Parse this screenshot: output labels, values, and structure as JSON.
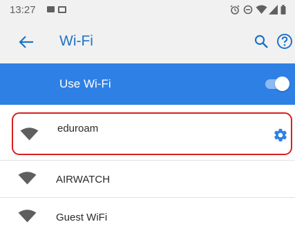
{
  "status_bar": {
    "time": "13:27",
    "left_icons": [
      "photo-icon",
      "mail-icon"
    ],
    "right_icons": [
      "alarm-icon",
      "do-not-disturb-icon",
      "wifi-signal-icon",
      "cell-signal-icon",
      "battery-icon"
    ]
  },
  "app_bar": {
    "title": "Wi-Fi",
    "back_icon": "arrow-back-icon",
    "actions": [
      "search-icon",
      "help-icon"
    ]
  },
  "master_switch": {
    "label": "Use Wi-Fi",
    "enabled": true
  },
  "networks": [
    {
      "ssid": "eduroam",
      "connected": true,
      "has_settings": true,
      "highlighted": true
    },
    {
      "ssid": "AIRWATCH",
      "connected": false,
      "has_settings": false,
      "highlighted": false
    },
    {
      "ssid": "Guest WiFi",
      "connected": false,
      "has_settings": false,
      "highlighted": false
    }
  ],
  "colors": {
    "accent_blue": "#2f80e4",
    "title_blue": "#1e73c6",
    "highlight_red": "#d81f1f",
    "status_bar_bg": "#f1f1f1"
  }
}
